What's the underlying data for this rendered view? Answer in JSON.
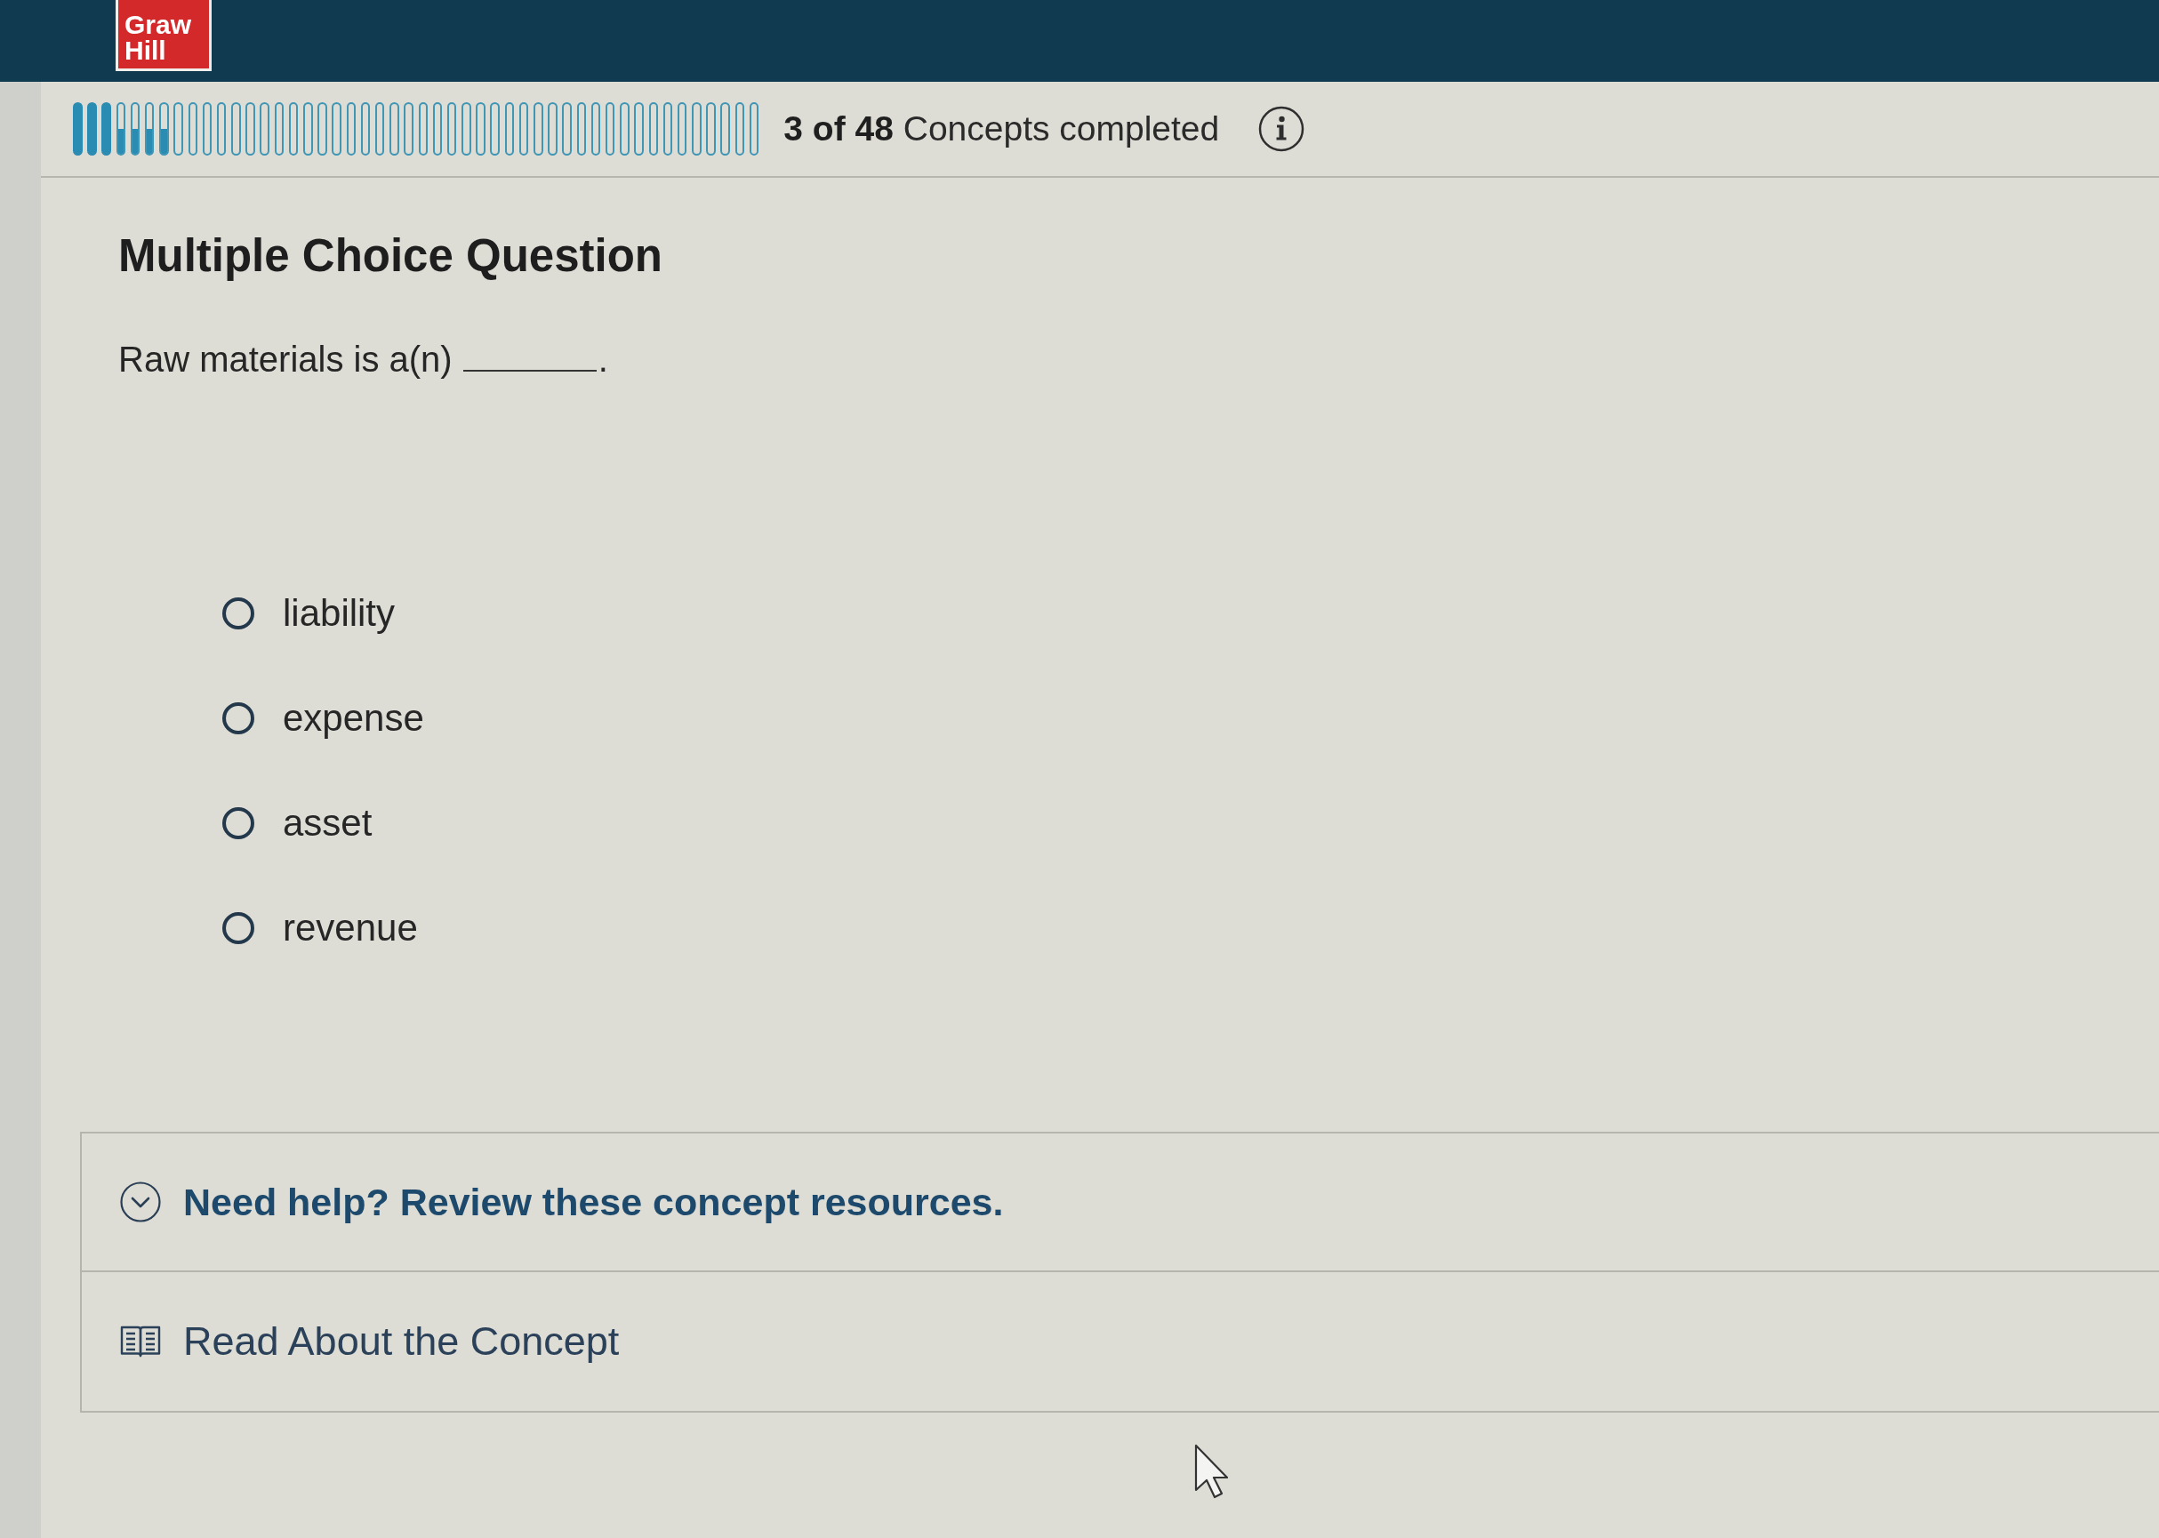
{
  "header": {
    "logo": {
      "lines": [
        "Graw",
        "Hill"
      ]
    }
  },
  "progress": {
    "segments": [
      {
        "completed": true,
        "in_progress": false
      },
      {
        "completed": true,
        "in_progress": false
      },
      {
        "completed": true,
        "in_progress": false
      },
      {
        "completed": false,
        "in_progress": true
      },
      {
        "completed": false,
        "in_progress": true
      },
      {
        "completed": false,
        "in_progress": true
      },
      {
        "completed": false,
        "in_progress": true
      },
      {
        "completed": false,
        "in_progress": false
      },
      {
        "completed": false,
        "in_progress": false
      },
      {
        "completed": false,
        "in_progress": false
      },
      {
        "completed": false,
        "in_progress": false
      },
      {
        "completed": false,
        "in_progress": false
      },
      {
        "completed": false,
        "in_progress": false
      },
      {
        "completed": false,
        "in_progress": false
      },
      {
        "completed": false,
        "in_progress": false
      },
      {
        "completed": false,
        "in_progress": false
      },
      {
        "completed": false,
        "in_progress": false
      },
      {
        "completed": false,
        "in_progress": false
      },
      {
        "completed": false,
        "in_progress": false
      },
      {
        "completed": false,
        "in_progress": false
      },
      {
        "completed": false,
        "in_progress": false
      },
      {
        "completed": false,
        "in_progress": false
      },
      {
        "completed": false,
        "in_progress": false
      },
      {
        "completed": false,
        "in_progress": false
      },
      {
        "completed": false,
        "in_progress": false
      },
      {
        "completed": false,
        "in_progress": false
      },
      {
        "completed": false,
        "in_progress": false
      },
      {
        "completed": false,
        "in_progress": false
      },
      {
        "completed": false,
        "in_progress": false
      },
      {
        "completed": false,
        "in_progress": false
      },
      {
        "completed": false,
        "in_progress": false
      },
      {
        "completed": false,
        "in_progress": false
      },
      {
        "completed": false,
        "in_progress": false
      },
      {
        "completed": false,
        "in_progress": false
      },
      {
        "completed": false,
        "in_progress": false
      },
      {
        "completed": false,
        "in_progress": false
      },
      {
        "completed": false,
        "in_progress": false
      },
      {
        "completed": false,
        "in_progress": false
      },
      {
        "completed": false,
        "in_progress": false
      },
      {
        "completed": false,
        "in_progress": false
      },
      {
        "completed": false,
        "in_progress": false
      },
      {
        "completed": false,
        "in_progress": false
      },
      {
        "completed": false,
        "in_progress": false
      },
      {
        "completed": false,
        "in_progress": false
      },
      {
        "completed": false,
        "in_progress": false
      },
      {
        "completed": false,
        "in_progress": false
      },
      {
        "completed": false,
        "in_progress": false
      },
      {
        "completed": false,
        "in_progress": false
      }
    ],
    "status": "**3 of 48** Concepts completed"
  },
  "question": {
    "heading": "Multiple Choice Question",
    "prompt": "Raw materials is a(n)",
    "prompt_end": ".",
    "options": [
      {
        "label": "liability",
        "selected": false
      },
      {
        "label": "expense",
        "selected": false
      },
      {
        "label": "asset",
        "selected": false
      },
      {
        "label": "revenue",
        "selected": false
      }
    ]
  },
  "help": {
    "title": "Need help? Review these concept resources.",
    "expanded": true,
    "resources": [
      {
        "kind": "reading",
        "label": "Read About the Concept"
      }
    ]
  }
}
